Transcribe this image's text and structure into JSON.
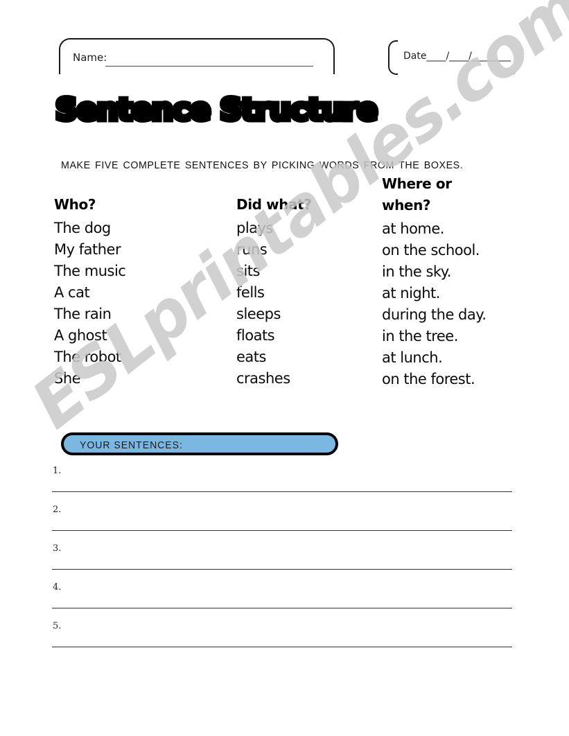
{
  "header": {
    "name_label": "Name:",
    "date_label": "Date____/____/________",
    "date_period": "."
  },
  "title": "Sentence Structure",
  "instruction": "MAKE FIVE COMPLETE SENTENCES BY PICKING WORDS FROM THE BOXES.",
  "columns": [
    {
      "id": "who",
      "heading": "Who?",
      "words": [
        "The dog",
        "My father",
        "The music",
        "A cat",
        "The rain",
        "A ghost",
        "The robot",
        "She"
      ]
    },
    {
      "id": "did-what",
      "heading": "Did what?",
      "words": [
        "plays",
        "runs",
        "sits",
        "fells",
        "sleeps",
        "floats",
        "eats",
        "crashes"
      ]
    },
    {
      "id": "where-or-when",
      "heading": "Where or\nwhen?",
      "words": [
        "at home.",
        "on the school.",
        "in the sky.",
        "at night.",
        "during the day.",
        "in the tree.",
        "at lunch.",
        "on the forest."
      ]
    }
  ],
  "sentences_section": {
    "banner_label": "YOUR SENTENCES:",
    "banner_color": "#7ab8e2",
    "lines": [
      {
        "number": "1."
      },
      {
        "number": "2."
      },
      {
        "number": "3."
      },
      {
        "number": "4."
      },
      {
        "number": "5."
      }
    ]
  },
  "watermark": {
    "text": "ESLprintables.com",
    "color": "#c9c9c9"
  }
}
